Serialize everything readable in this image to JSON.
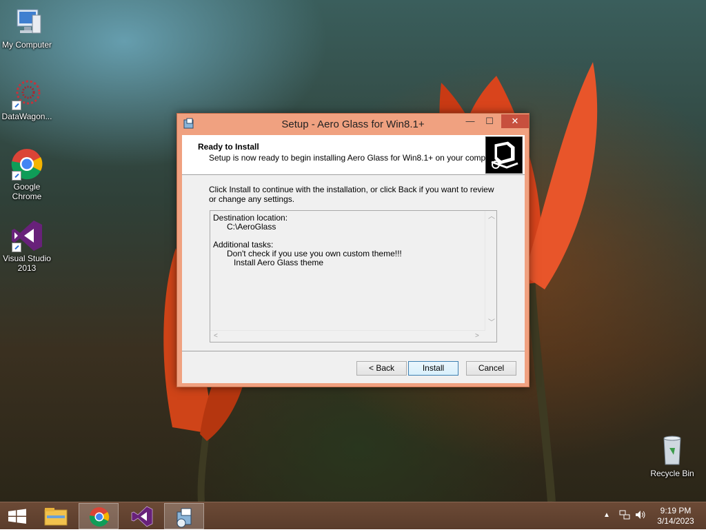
{
  "desktop": {
    "icons": [
      {
        "label": "My Computer",
        "icon": "computer-icon"
      },
      {
        "label": "DataWagon...",
        "icon": "datawagon-icon"
      },
      {
        "label": "Google Chrome",
        "icon": "chrome-icon"
      },
      {
        "label": "Visual Studio 2013",
        "icon": "visual-studio-icon"
      },
      {
        "label": "Recycle Bin",
        "icon": "recycle-bin-icon"
      }
    ]
  },
  "dialog": {
    "title": "Setup - Aero Glass for Win8.1+",
    "header_title": "Ready to Install",
    "header_subtitle": "Setup is now ready to begin installing Aero Glass for Win8.1+ on your computer.",
    "body_text": "Click Install to continue with the installation, or click Back if you want to review or change any settings.",
    "memo_text": "Destination location:\n      C:\\AeroGlass\n\nAdditional tasks:\n      Don't check if you use you own custom theme!!!\n         Install Aero Glass theme",
    "buttons": {
      "back": "< Back",
      "install": "Install",
      "cancel": "Cancel"
    },
    "caption_buttons": {
      "close": "✕",
      "maximize": "☐",
      "minimize": "—"
    }
  },
  "taskbar": {
    "items": [
      "start-icon",
      "file-explorer-icon",
      "chrome-icon",
      "visual-studio-icon",
      "setup-icon"
    ],
    "time": "9:19 PM",
    "date": "3/14/2023",
    "tray_arrow": "▲"
  },
  "colors": {
    "dialog_frame": "#f0a180",
    "close_button": "#c7503e",
    "taskbar": "#5a3c2b"
  }
}
